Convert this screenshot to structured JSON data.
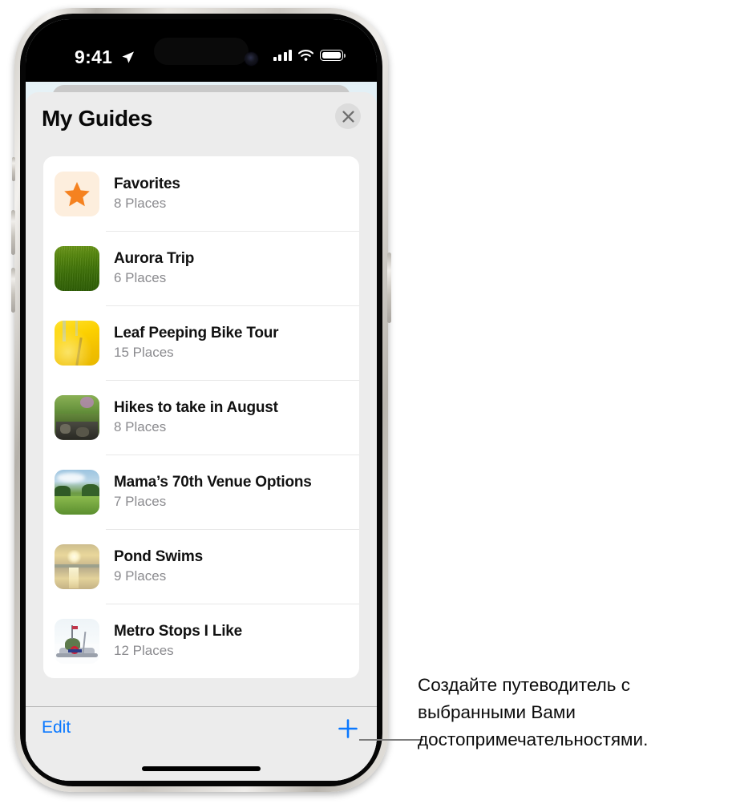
{
  "status_bar": {
    "time": "9:41",
    "location_icon": "location-arrow-icon",
    "cellular_icon": "cellular-signal-icon",
    "wifi_icon": "wifi-icon",
    "battery_icon": "battery-icon"
  },
  "sheet": {
    "title": "My Guides",
    "close_icon": "close-icon",
    "close_label": "Close"
  },
  "guides": [
    {
      "title": "Favorites",
      "places": "8 Places",
      "thumb": "star-icon",
      "thumb_kind": "favorites"
    },
    {
      "title": "Aurora Trip",
      "places": "6 Places",
      "thumb": "grass-field-thumbnail",
      "thumb_kind": "aurora"
    },
    {
      "title": "Leaf Peeping Bike Tour",
      "places": "15 Places",
      "thumb": "yellow-leaves-thumbnail",
      "thumb_kind": "leaf"
    },
    {
      "title": "Hikes to take in August",
      "places": "8 Places",
      "thumb": "forest-trail-thumbnail",
      "thumb_kind": "hike"
    },
    {
      "title": "Mama’s 70th Venue Options",
      "places": "7 Places",
      "thumb": "meadow-sky-thumbnail",
      "thumb_kind": "meadow"
    },
    {
      "title": "Pond Swims",
      "places": "9 Places",
      "thumb": "sunset-lake-thumbnail",
      "thumb_kind": "pond"
    },
    {
      "title": "Metro Stops I Like",
      "places": "12 Places",
      "thumb": "metro-monument-thumbnail",
      "thumb_kind": "metro"
    }
  ],
  "toolbar": {
    "edit_label": "Edit",
    "add_icon": "plus-icon",
    "add_label": "Add Guide"
  },
  "callout": {
    "text": "Создайте путеводитель с выбранными Вами достопримечательностями."
  },
  "colors": {
    "accent_blue": "#0a78ff",
    "star_orange": "#f58220",
    "sheet_bg": "#ececec",
    "card_bg": "#ffffff",
    "subtitle_gray": "#8b8b8f"
  }
}
